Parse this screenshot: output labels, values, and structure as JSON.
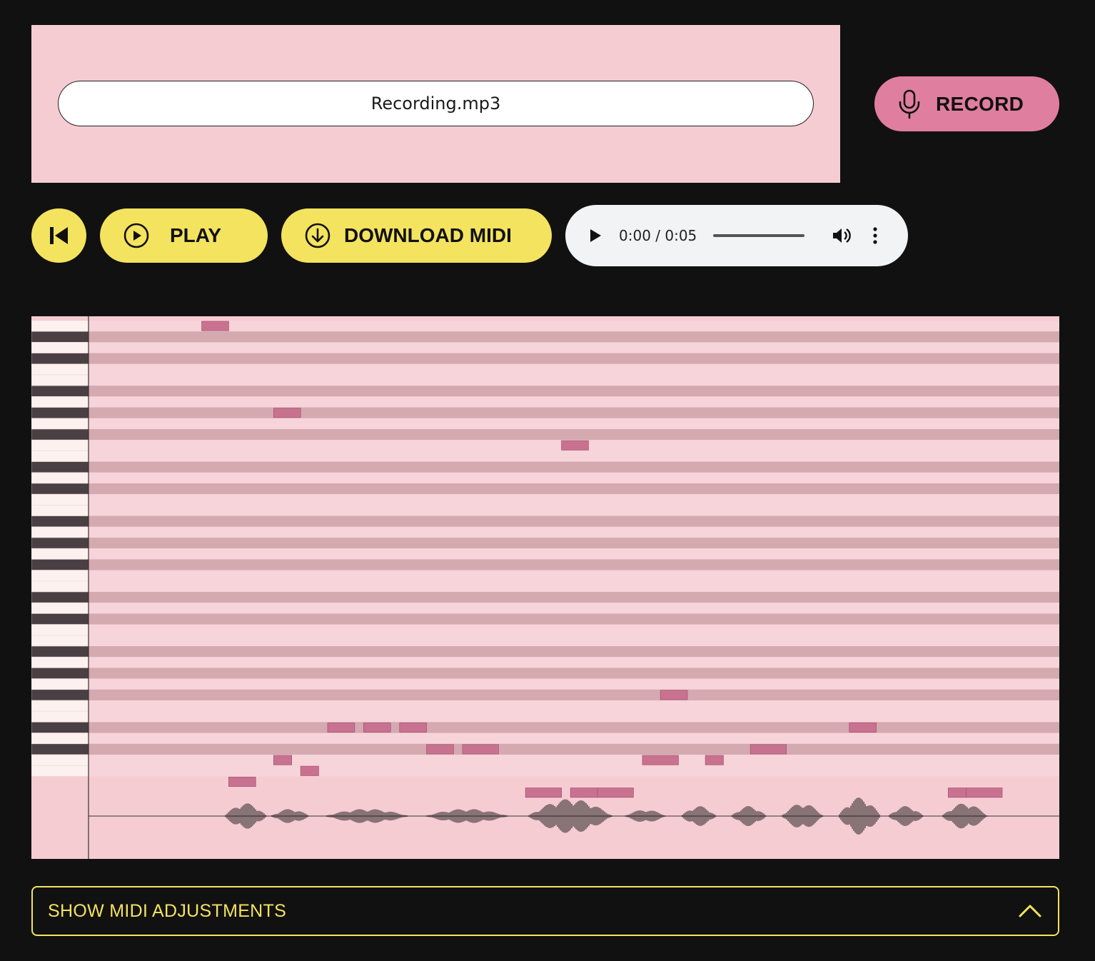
{
  "file": {
    "name": "Recording.mp3"
  },
  "record": {
    "label": "RECORD",
    "icon": "microphone-icon"
  },
  "toolbar": {
    "skip_icon": "skip-to-start-icon",
    "play_label": "PLAY",
    "play_icon": "play-circle-icon",
    "download_label": "DOWNLOAD MIDI",
    "download_icon": "download-circle-icon"
  },
  "audio_player": {
    "current_time": "0:00",
    "duration": "0:05",
    "time_text": "0:00 / 0:05",
    "progress": 0
  },
  "colors": {
    "background": "#111111",
    "panel_pink": "#f6ccd3",
    "record_pink": "#e07ea0",
    "button_yellow": "#f4e35e",
    "note_color": "#c9728f",
    "row_dark": "#d4a9b0"
  },
  "piano_roll": {
    "notes": [
      {
        "start": 0.11,
        "end": 0.14,
        "row": 0
      },
      {
        "start": 0.19,
        "end": 0.22,
        "row": 8
      },
      {
        "start": 0.51,
        "end": 0.54,
        "row": 11
      },
      {
        "start": 0.62,
        "end": 0.65,
        "row": 34
      },
      {
        "start": 0.25,
        "end": 0.28,
        "row": 37
      },
      {
        "start": 0.29,
        "end": 0.32,
        "row": 37
      },
      {
        "start": 0.33,
        "end": 0.36,
        "row": 37
      },
      {
        "start": 0.36,
        "end": 0.39,
        "row": 39
      },
      {
        "start": 0.4,
        "end": 0.44,
        "row": 39
      },
      {
        "start": 0.72,
        "end": 0.76,
        "row": 39
      },
      {
        "start": 0.83,
        "end": 0.86,
        "row": 37
      },
      {
        "start": 0.19,
        "end": 0.21,
        "row": 40
      },
      {
        "start": 0.22,
        "end": 0.24,
        "row": 41
      },
      {
        "start": 0.14,
        "end": 0.17,
        "row": 42
      },
      {
        "start": 0.6,
        "end": 0.64,
        "row": 40
      },
      {
        "start": 0.67,
        "end": 0.69,
        "row": 40
      },
      {
        "start": 0.47,
        "end": 0.51,
        "row": 43
      },
      {
        "start": 0.52,
        "end": 0.55,
        "row": 43
      },
      {
        "start": 0.55,
        "end": 0.59,
        "row": 43
      },
      {
        "start": 0.94,
        "end": 0.96,
        "row": 43
      },
      {
        "start": 0.96,
        "end": 1.0,
        "row": 43
      }
    ]
  },
  "adjustments": {
    "label": "SHOW MIDI ADJUSTMENTS",
    "expanded": false,
    "chevron_icon": "chevron-up-icon"
  }
}
